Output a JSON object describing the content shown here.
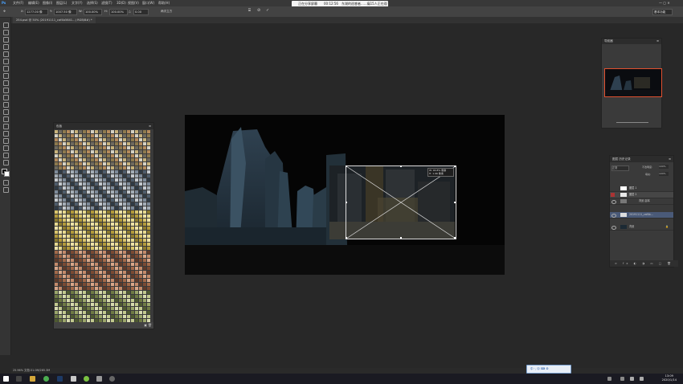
{
  "menu": [
    "文件(F)",
    "编辑(E)",
    "图像(I)",
    "图层(L)",
    "文字(Y)",
    "选择(S)",
    "滤镜(T)",
    "3D(D)",
    "视图(V)",
    "窗口(W)",
    "帮助(H)"
  ],
  "recording_notice": {
    "label": "正在分享屏幕",
    "time": "00:12:56",
    "extra": "东湖的巡睿者......痛15人正在观看"
  },
  "options": {
    "x_label": "X:",
    "x_value": "1277.00 像",
    "y_label": "Y:",
    "y_value": "1007.50 像",
    "w_label": "W:",
    "w_value": "100.00%",
    "h_label": "H:",
    "h_value": "100.00%",
    "angle_label": "△",
    "angle_value": "0.00",
    "interp": "两次立方",
    "right": "基本功能"
  },
  "document_tab": "254.psd @ 50% (20191111_caf4b5641...) RGB/8#) *",
  "transform_tip": {
    "line1": "W: 90.8% 像素",
    "line2": "H: 1.96 像素"
  },
  "swatches_title": "色板",
  "navigator_title": "导航器",
  "layers": {
    "tabs": "图层  历史记录",
    "blend": "正常",
    "opacity_label": "不透明度:",
    "opacity": "100%",
    "fill_label": "填充:",
    "fill": "100%",
    "rows": [
      {
        "name": "图层 1"
      },
      {
        "name": "图层 2"
      },
      {
        "name": "背景 副本"
      },
      {
        "name": "20191111_caf4b..."
      },
      {
        "name": "背景"
      }
    ]
  },
  "status": "25.96%   文档:31.0M/265.3M",
  "ime": "中 ·, ☺ ⌨ ⚙",
  "clock": {
    "time": "13:09",
    "date": "2020/1/14"
  },
  "colors": {
    "accent": "#e0502f",
    "bg": "#282828"
  }
}
